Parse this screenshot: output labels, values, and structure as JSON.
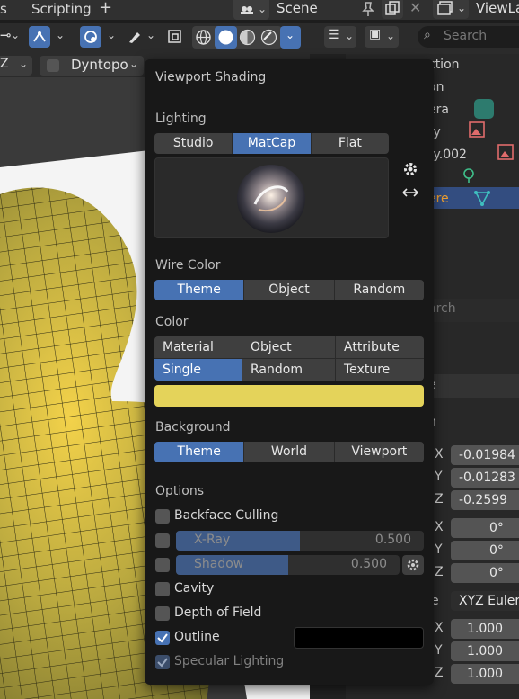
{
  "topbar": {
    "tab_scripting": "Scripting",
    "add_tab": "+",
    "scene_name": "Scene",
    "view_layer": "ViewLa"
  },
  "toolbar": {
    "axis_label": "Z",
    "dyntopo_label": "Dyntopo"
  },
  "outliner": {
    "search_placeholder": "Search",
    "items": [
      "ction",
      "on",
      "era",
      "ty",
      "ty.002",
      "",
      "ere"
    ]
  },
  "properties": {
    "search_placeholder": "arch",
    "header": "e",
    "row_n": "n",
    "location_axes": [
      "X",
      "Y",
      "Z"
    ],
    "location_values": [
      "-0.01984",
      "-0.01283",
      "-0.2599"
    ],
    "rotation_axes": [
      "X",
      "Y",
      "Z"
    ],
    "rotation_values": [
      "0°",
      "0°",
      "0°"
    ],
    "mode_label": "e",
    "rotation_mode": "XYZ Euler",
    "scale_axes": [
      "X",
      "Y",
      "Z"
    ],
    "scale_values": [
      "1.000",
      "1.000",
      "1.000"
    ]
  },
  "popover": {
    "title": "Viewport Shading",
    "lighting": {
      "label": "Lighting",
      "options": [
        "Studio",
        "MatCap",
        "Flat"
      ],
      "selected": "MatCap"
    },
    "wire_color": {
      "label": "Wire Color",
      "options": [
        "Theme",
        "Object",
        "Random"
      ],
      "selected": "Theme"
    },
    "color": {
      "label": "Color",
      "options": [
        "Material",
        "Object",
        "Attribute",
        "Single",
        "Random",
        "Texture"
      ],
      "selected": "Single",
      "swatch": "#e4d35a"
    },
    "background": {
      "label": "Background",
      "options": [
        "Theme",
        "World",
        "Viewport"
      ],
      "selected": "Theme"
    },
    "options": {
      "label": "Options",
      "backface_culling": "Backface Culling",
      "xray": {
        "label": "X-Ray",
        "value": "0.500",
        "fraction": 0.5
      },
      "shadow": {
        "label": "Shadow",
        "value": "0.500",
        "fraction": 0.5
      },
      "cavity": "Cavity",
      "depth_of_field": "Depth of Field",
      "outline": "Outline",
      "outline_color": "#000000",
      "specular_lighting": "Specular Lighting"
    }
  },
  "colors": {
    "accent": "#4772b3",
    "mesh": "#c9b441"
  }
}
